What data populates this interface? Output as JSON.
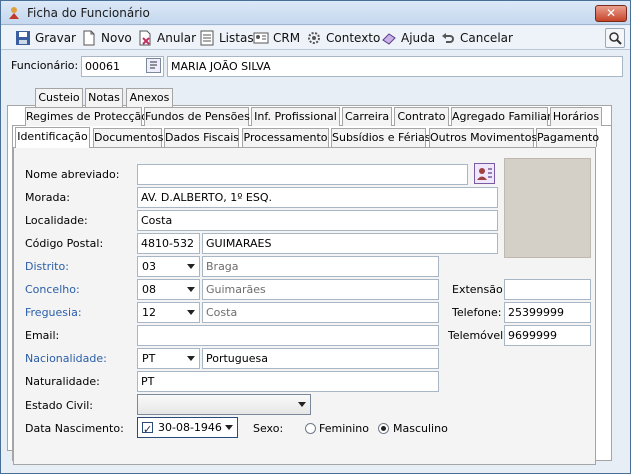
{
  "window": {
    "title": "Ficha do Funcionário",
    "close": "✕"
  },
  "toolbar": {
    "gravar": "Gravar",
    "novo": "Novo",
    "anular": "Anular",
    "listas": "Listas",
    "crm": "CRM",
    "contexto": "Contexto",
    "ajuda": "Ajuda",
    "cancelar": "Cancelar"
  },
  "employee": {
    "label": "Funcionário:",
    "number": "00061",
    "name": "MARIA JOÃO SILVA"
  },
  "tabs": {
    "row1": [
      "Custeio",
      "Notas",
      "Anexos"
    ],
    "row2": [
      "Regimes de Protecção",
      "Fundos de Pensões",
      "Inf. Profissional",
      "Carreira",
      "Contrato",
      "Agregado Familiar",
      "Horários"
    ],
    "row3": [
      "Identificação",
      "Documentos",
      "Dados Fiscais",
      "Processamento",
      "Subsídios e Férias",
      "Outros Movimentos",
      "Pagamento"
    ]
  },
  "form": {
    "nome_abreviado": {
      "label": "Nome abreviado:",
      "value": ""
    },
    "morada": {
      "label": "Morada:",
      "value": "AV. D.ALBERTO, 1º ESQ."
    },
    "localidade": {
      "label": "Localidade:",
      "value": "Costa"
    },
    "codigo_postal": {
      "label": "Código  Postal:",
      "code": "4810-532",
      "city": "GUIMARAES"
    },
    "distrito": {
      "label": "Distrito:",
      "code": "03",
      "name": "Braga"
    },
    "concelho": {
      "label": "Concelho:",
      "code": "08",
      "name": "Guimarães"
    },
    "freguesia": {
      "label": "Freguesia:",
      "code": "12",
      "name": "Costa"
    },
    "email": {
      "label": "Email:",
      "value": ""
    },
    "nacionalidade": {
      "label": "Nacionalidade:",
      "code": "PT",
      "name": "Portuguesa"
    },
    "naturalidade": {
      "label": "Naturalidade:",
      "value": "PT"
    },
    "estado_civil": {
      "label": "Estado Civil:",
      "value": ""
    },
    "data_nascimento": {
      "label": "Data Nascimento:",
      "value": "30-08-1946"
    },
    "sexo": {
      "label": "Sexo:",
      "feminino": "Feminino",
      "masculino": "Masculino",
      "selected": "Masculino"
    },
    "extensao": {
      "label": "Extensão:",
      "value": ""
    },
    "telefone": {
      "label": "Telefone:",
      "value": "25399999"
    },
    "telemovel": {
      "label": "Telemóvel:",
      "value": "9699999"
    }
  },
  "colors": {
    "titlebar": "#c5d8ee",
    "link_label": "#2a5ea8",
    "close": "#c7442a",
    "photo": "#d4d0c8"
  }
}
